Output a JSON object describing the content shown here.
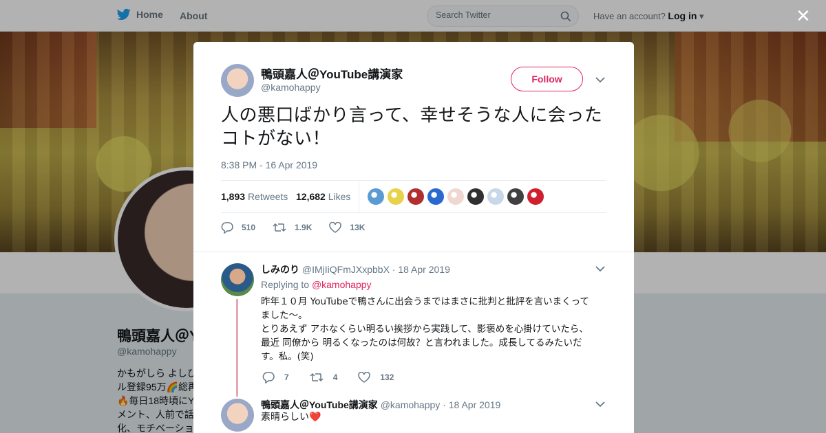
{
  "nav": {
    "home_label": "Home",
    "about_label": "About",
    "search_placeholder": "Search Twitter",
    "account_prompt": "Have an account?",
    "login_label": "Log in"
  },
  "background_profile": {
    "name": "鴨頭嘉人＠Y",
    "handle": "@kamohappy",
    "bio_lines": [
      "かもがしら よしひ",
      "ル登録95万🌈総再",
      "🔥毎日18時頃にY",
      "メント、人前で話",
      "化、モチベーショ"
    ]
  },
  "tweet": {
    "author_name": "鴨頭嘉人＠YouTube講演家",
    "author_handle": "@kamohappy",
    "follow_label": "Follow",
    "text": "人の悪口ばかり言って、幸せそうな人に会ったコトがない！",
    "timestamp": "8:38 PM - 16 Apr 2019",
    "retweets_count": "1,893",
    "retweets_label": "Retweets",
    "likes_count": "12,682",
    "likes_label": "Likes",
    "reply_count": "510",
    "retweet_action_count": "1.9K",
    "like_action_count": "13K"
  },
  "liker_colors": [
    "#5b9bd5",
    "#e8d24a",
    "#b03030",
    "#2a6ad0",
    "#f0d8d0",
    "#303030",
    "#c8d8e8",
    "#404040",
    "#d02030"
  ],
  "replies": [
    {
      "name": "しみのり",
      "handle": "@IMjIiQFmJXxpbbX",
      "date": "18 Apr 2019",
      "replying_to_label": "Replying to",
      "replying_to_handle": "@kamohappy",
      "body_lines": [
        "昨年１０月 YouTubeで鴨さんに出会うまではまさに批判と批評を言いまくって",
        "ました〜。",
        "とりあえず アホなくらい明るい挨拶から実践して、影褒めを心掛けていたら、",
        "最近 同僚から 明るくなったのは何故？と言われました。成長してるみたいだ",
        "す。私。(笑)"
      ],
      "reply_count": "7",
      "retweet_count": "4",
      "like_count": "132"
    },
    {
      "name": "鴨頭嘉人＠YouTube講演家",
      "handle": "@kamohappy",
      "date": "18 Apr 2019",
      "body": "素晴らしい❤️"
    }
  ],
  "colors": {
    "twitter_blue": "#1da1f2",
    "follow_accent": "#e0245e",
    "muted_text": "#657786"
  }
}
